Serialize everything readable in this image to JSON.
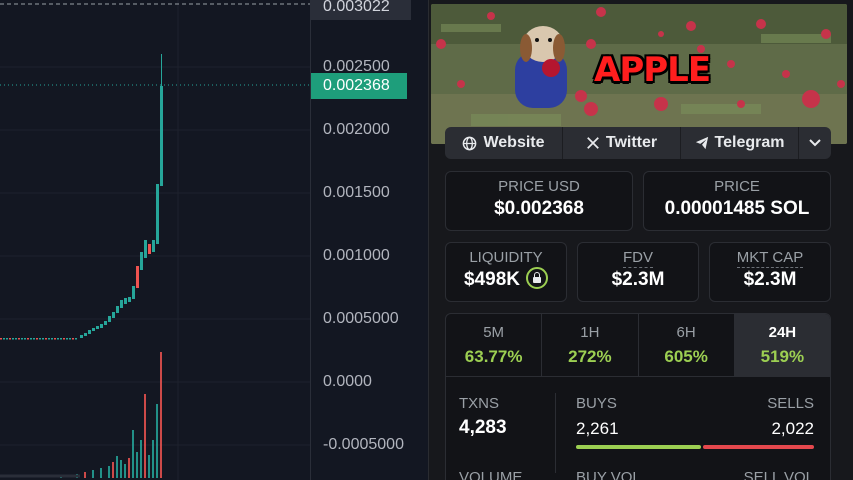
{
  "price_axis": {
    "top_label": "0.003022",
    "current_price": "0.002368",
    "labels": [
      "0.002500",
      "0.002000",
      "0.001500",
      "0.001000",
      "0.0005000",
      "0.0000",
      "-0.0005000"
    ]
  },
  "banner": {
    "title": "APPLE"
  },
  "links": {
    "website": "Website",
    "twitter": "Twitter",
    "telegram": "Telegram"
  },
  "price_usd": {
    "label": "PRICE USD",
    "value": "$0.002368"
  },
  "price_native": {
    "label": "PRICE",
    "value": "0.00001485 SOL"
  },
  "liquidity": {
    "label": "LIQUIDITY",
    "value": "$498K"
  },
  "fdv": {
    "label": "FDV",
    "value": "$2.3M"
  },
  "mkt_cap": {
    "label": "MKT CAP",
    "value": "$2.3M"
  },
  "timeframes": [
    {
      "label": "5M",
      "change": "63.77%"
    },
    {
      "label": "1H",
      "change": "272%"
    },
    {
      "label": "6H",
      "change": "605%"
    },
    {
      "label": "24H",
      "change": "519%"
    }
  ],
  "active_timeframe": "24H",
  "txns": {
    "label": "TXNS",
    "value": "4,283"
  },
  "buys": {
    "label": "BUYS",
    "value": "2,261",
    "count": 2261
  },
  "sells": {
    "label": "SELLS",
    "value": "2,022",
    "count": 2022
  },
  "volume": {
    "label": "VOLUME",
    "buy_label": "BUY VOL",
    "sell_label": "SELL VOL"
  },
  "colors": {
    "up": "#26a69a",
    "down": "#ef5350",
    "accent_green": "#9ccf52",
    "current_price_bg": "#1e9e7b"
  }
}
